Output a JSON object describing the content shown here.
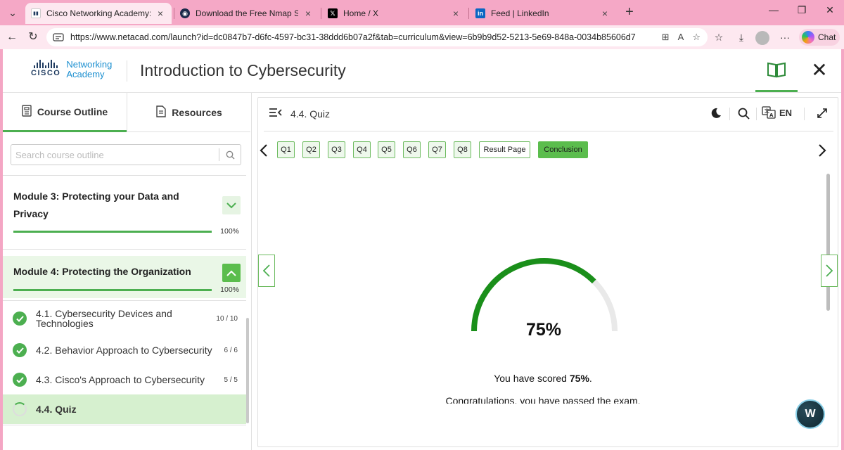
{
  "browser": {
    "tabs": [
      {
        "title": "Cisco Networking Academy: Introduction to Cybersecurity",
        "close": "×",
        "active": true
      },
      {
        "title": "Download the Free Nmap Security Scanner",
        "close": "×",
        "active": false
      },
      {
        "title": "Home / X",
        "close": "×",
        "active": false
      },
      {
        "title": "Feed | LinkedIn",
        "close": "×",
        "active": false
      }
    ],
    "url": "https://www.netacad.com/launch?id=dc0847b7-d6fc-4597-bc31-38ddd6b07a2f&tab=curriculum&view=6b9b9d52-5213-5e69-848a-0034b85606d7",
    "chat_label": "Chat"
  },
  "header": {
    "logo_word": "CISCO",
    "logo_line1": "Networking",
    "logo_line2": "Academy",
    "title": "Introduction to Cybersecurity"
  },
  "sidebar": {
    "tab_outline": "Course Outline",
    "tab_resources": "Resources",
    "search_placeholder": "Search course outline",
    "modules": [
      {
        "title": "Module 3: Protecting your Data and Privacy",
        "progress": "100%",
        "expanded": false
      },
      {
        "title": "Module 4: Protecting the Organization",
        "progress": "100%",
        "expanded": true
      }
    ],
    "lessons": [
      {
        "title": "4.1. Cybersecurity Devices and Technologies",
        "count": "10 / 10"
      },
      {
        "title": "4.2. Behavior Approach to Cybersecurity",
        "count": "6 / 6"
      },
      {
        "title": "4.3. Cisco's Approach to Cybersecurity",
        "count": "5 / 5"
      },
      {
        "title": "4.4. Quiz",
        "count": ""
      }
    ]
  },
  "content": {
    "title": "4.4. Quiz",
    "language": "EN",
    "quiz_nav": [
      "Q1",
      "Q2",
      "Q3",
      "Q4",
      "Q5",
      "Q6",
      "Q7",
      "Q8",
      "Result Page",
      "Conclusion"
    ],
    "active_nav": "Conclusion",
    "score": "75%",
    "score_fraction": 0.75,
    "score_prefix": "You have scored ",
    "score_value": "75%",
    "score_suffix": ".",
    "congrats": "Congratulations, you have passed the exam."
  },
  "colors": {
    "accent": "#4caf50",
    "gauge_fill": "#1a8f1a",
    "gauge_track": "#e9e9e9",
    "browser_frame": "#f5a8c6"
  }
}
